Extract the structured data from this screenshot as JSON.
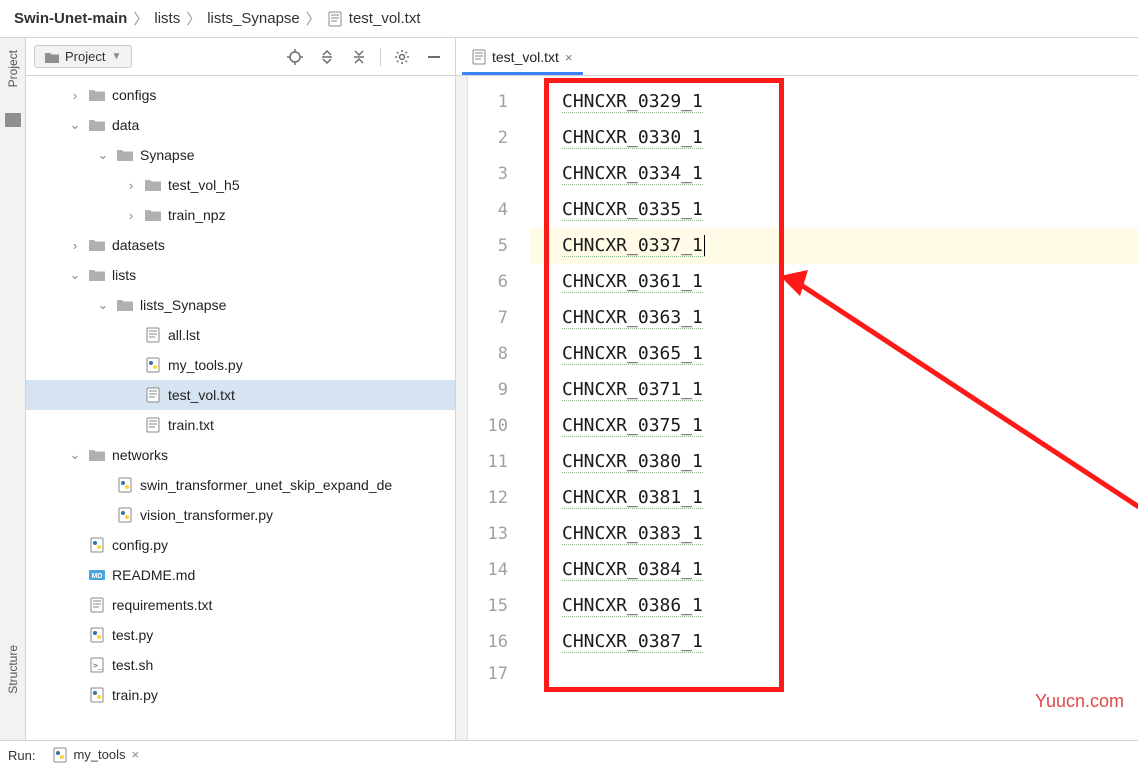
{
  "breadcrumb": [
    "Swin-Unet-main",
    "lists",
    "lists_Synapse",
    "test_vol.txt"
  ],
  "sidebar": {
    "title": "Project",
    "vertical_labels": [
      "Project",
      "Structure"
    ],
    "tree": [
      {
        "depth": 0,
        "chev": "right",
        "icon": "folder",
        "label": "configs"
      },
      {
        "depth": 0,
        "chev": "down",
        "icon": "folder",
        "label": "data"
      },
      {
        "depth": 1,
        "chev": "down",
        "icon": "folder",
        "label": "Synapse"
      },
      {
        "depth": 2,
        "chev": "right",
        "icon": "folder",
        "label": "test_vol_h5"
      },
      {
        "depth": 2,
        "chev": "right",
        "icon": "folder",
        "label": "train_npz"
      },
      {
        "depth": 0,
        "chev": "right",
        "icon": "folder",
        "label": "datasets"
      },
      {
        "depth": 0,
        "chev": "down",
        "icon": "folder",
        "label": "lists"
      },
      {
        "depth": 1,
        "chev": "down",
        "icon": "folder",
        "label": "lists_Synapse"
      },
      {
        "depth": 2,
        "chev": "",
        "icon": "txt",
        "label": "all.lst"
      },
      {
        "depth": 2,
        "chev": "",
        "icon": "py",
        "label": "my_tools.py"
      },
      {
        "depth": 2,
        "chev": "",
        "icon": "txt",
        "label": "test_vol.txt",
        "selected": true
      },
      {
        "depth": 2,
        "chev": "",
        "icon": "txt",
        "label": "train.txt"
      },
      {
        "depth": 0,
        "chev": "down",
        "icon": "folder",
        "label": "networks"
      },
      {
        "depth": 1,
        "chev": "",
        "icon": "py",
        "label": "swin_transformer_unet_skip_expand_de"
      },
      {
        "depth": 1,
        "chev": "",
        "icon": "py",
        "label": "vision_transformer.py"
      },
      {
        "depth": 0,
        "chev": "",
        "icon": "py",
        "label": "config.py"
      },
      {
        "depth": 0,
        "chev": "",
        "icon": "md",
        "label": "README.md"
      },
      {
        "depth": 0,
        "chev": "",
        "icon": "txt",
        "label": "requirements.txt"
      },
      {
        "depth": 0,
        "chev": "",
        "icon": "py",
        "label": "test.py"
      },
      {
        "depth": 0,
        "chev": "",
        "icon": "sh",
        "label": "test.sh"
      },
      {
        "depth": 0,
        "chev": "",
        "icon": "py",
        "label": "train.py"
      }
    ]
  },
  "editor": {
    "tab_label": "test_vol.txt",
    "lines": [
      "CHNCXR_0329_1",
      "CHNCXR_0330_1",
      "CHNCXR_0334_1",
      "CHNCXR_0335_1",
      "CHNCXR_0337_1",
      "CHNCXR_0361_1",
      "CHNCXR_0363_1",
      "CHNCXR_0365_1",
      "CHNCXR_0371_1",
      "CHNCXR_0375_1",
      "CHNCXR_0380_1",
      "CHNCXR_0381_1",
      "CHNCXR_0383_1",
      "CHNCXR_0384_1",
      "CHNCXR_0386_1",
      "CHNCXR_0387_1"
    ],
    "current_line_index": 4
  },
  "bottom": {
    "run_label": "Run:",
    "run_tab": "my_tools"
  },
  "watermark": "Yuucn.com"
}
